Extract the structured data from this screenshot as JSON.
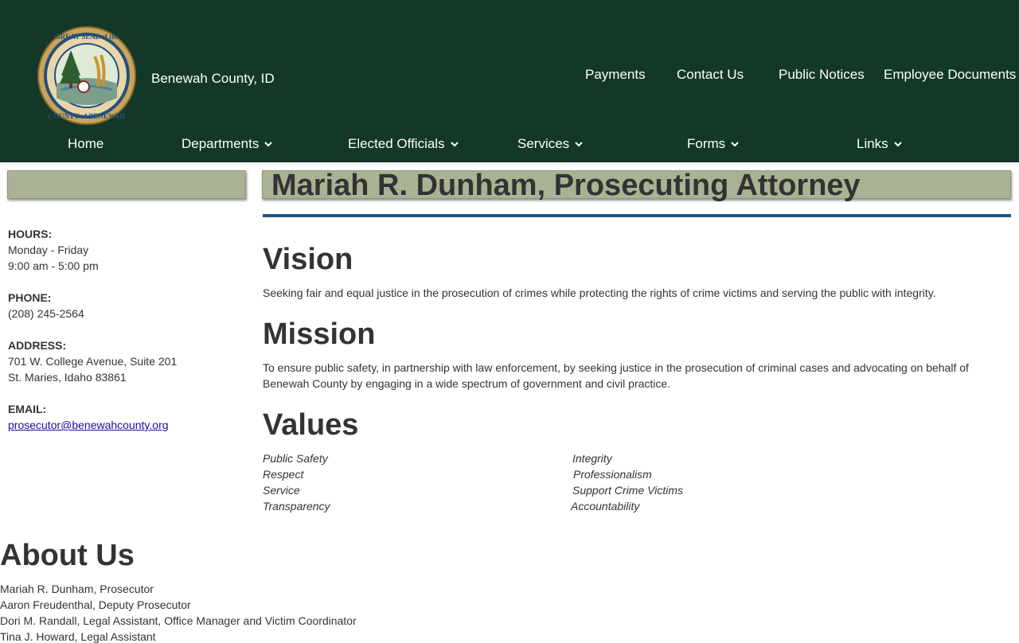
{
  "header": {
    "site_name": "Benewah County, ID",
    "seal_text_top": "GREAT SEAL of the",
    "seal_text_bottom": "COUNTY of BENEWAH",
    "utility_links": [
      "Payments",
      "Contact Us",
      "Public Notices",
      "Employee Documents"
    ],
    "nav": [
      {
        "label": "Home",
        "icon": null
      },
      {
        "label": "Departments",
        "icon": "chevron-down-icon"
      },
      {
        "label": "Elected Officials",
        "icon": "chevron-down-icon"
      },
      {
        "label": "Services",
        "icon": "chevron-down-icon"
      },
      {
        "label": "Forms",
        "icon": "chevron-down-icon"
      },
      {
        "label": "Links",
        "icon": "chevron-down-icon"
      }
    ]
  },
  "sidebar": {
    "hours_label": "HOURS:",
    "hours_days": "Monday - Friday",
    "hours_time": "9:00 am - 5:00 pm",
    "phone_label": "PHONE:",
    "phone": "(208) 245-2564",
    "address_label": "ADDRESS:",
    "address_line1": "701 W. College Avenue, Suite 201",
    "address_line2": "St. Maries, Idaho 83861",
    "email_label": "EMAIL:",
    "email": "prosecutor@benewahcounty.org"
  },
  "main": {
    "title": "Mariah R. Dunham, Prosecuting Attorney",
    "vision_heading": "Vision",
    "vision_text": "Seeking fair and equal justice in the prosecution of crimes while protecting the rights of crime victims and serving the public with integrity.",
    "mission_heading": "Mission",
    "mission_text_line1": "To ensure public safety, in partnership with law enforcement, by seeking justice in the prosecution of criminal cases and advocating on behalf of",
    "mission_text_line2": "Benewah County by engaging in a wide spectrum of government and civil practice.",
    "values_heading": "Values",
    "values_left": [
      "Public Safety",
      "Respect",
      "Service",
      "Transparency"
    ],
    "values_right": [
      "Integrity",
      "Professionalism",
      "Support Crime Victims",
      "Accountability"
    ]
  },
  "about": {
    "heading": "About Us",
    "staff": [
      "Mariah R. Dunham, Prosecutor",
      "Aaron Freudenthal, Deputy Prosecutor",
      "Dori M. Randall, Legal Assistant, Office Manager and Victim Coordinator",
      "Tina J. Howard, Legal Assistant"
    ]
  },
  "colors": {
    "header_bg": "#133827",
    "title_box_bg": "#a9b394",
    "title_rule": "#1f5583",
    "link": "#1a0dab"
  }
}
